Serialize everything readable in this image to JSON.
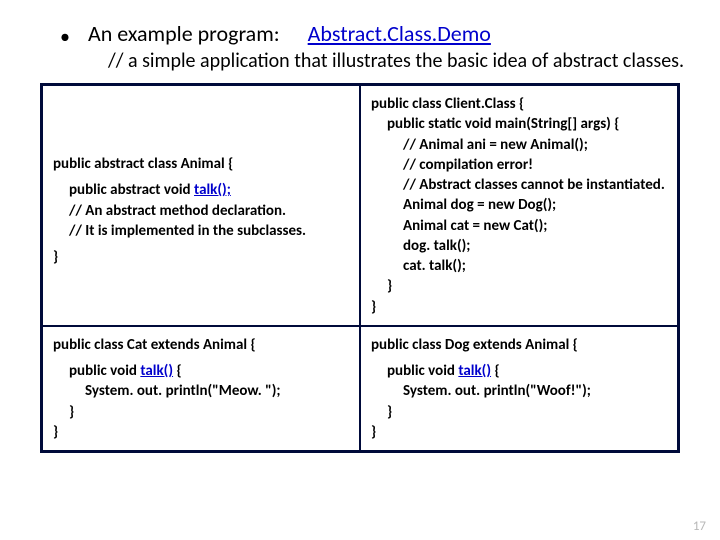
{
  "header": {
    "title": "An example program:",
    "link": "Abstract.Class.Demo",
    "subtitle": "// a simple application that illustrates the basic idea of abstract classes."
  },
  "cells": {
    "tl": {
      "l1": "public abstract class Animal {",
      "l2": "public abstract void ",
      "l2m": "talk();",
      "l3": "// An abstract method declaration.",
      "l4": "// It is implemented in the subclasses.",
      "l5": "}"
    },
    "tr": {
      "l1": "public class Client.Class {",
      "l2": "public static void main(String[] args) {",
      "l3": "// Animal ani = new Animal();",
      "l4": "// compilation error!",
      "l5": "// Abstract classes cannot be instantiated.",
      "l6": "Animal dog = new Dog();",
      "l7": "Animal cat = new Cat();",
      "l8": "dog. talk();",
      "l9": "cat. talk();",
      "l10": "}",
      "l11": "}"
    },
    "bl": {
      "l1": "public class Cat extends Animal {",
      "l2": "public void ",
      "l2m": "talk()",
      "l2e": " {",
      "l3": "System. out. println(\"Meow. \");",
      "l4": "}",
      "l5": "}"
    },
    "br": {
      "l1": "public class Dog extends Animal {",
      "l2": "public void ",
      "l2m": "talk()",
      "l2e": " {",
      "l3": "System. out. println(\"Woof!\");",
      "l4": "}",
      "l5": "}"
    }
  },
  "pagenum": "17"
}
